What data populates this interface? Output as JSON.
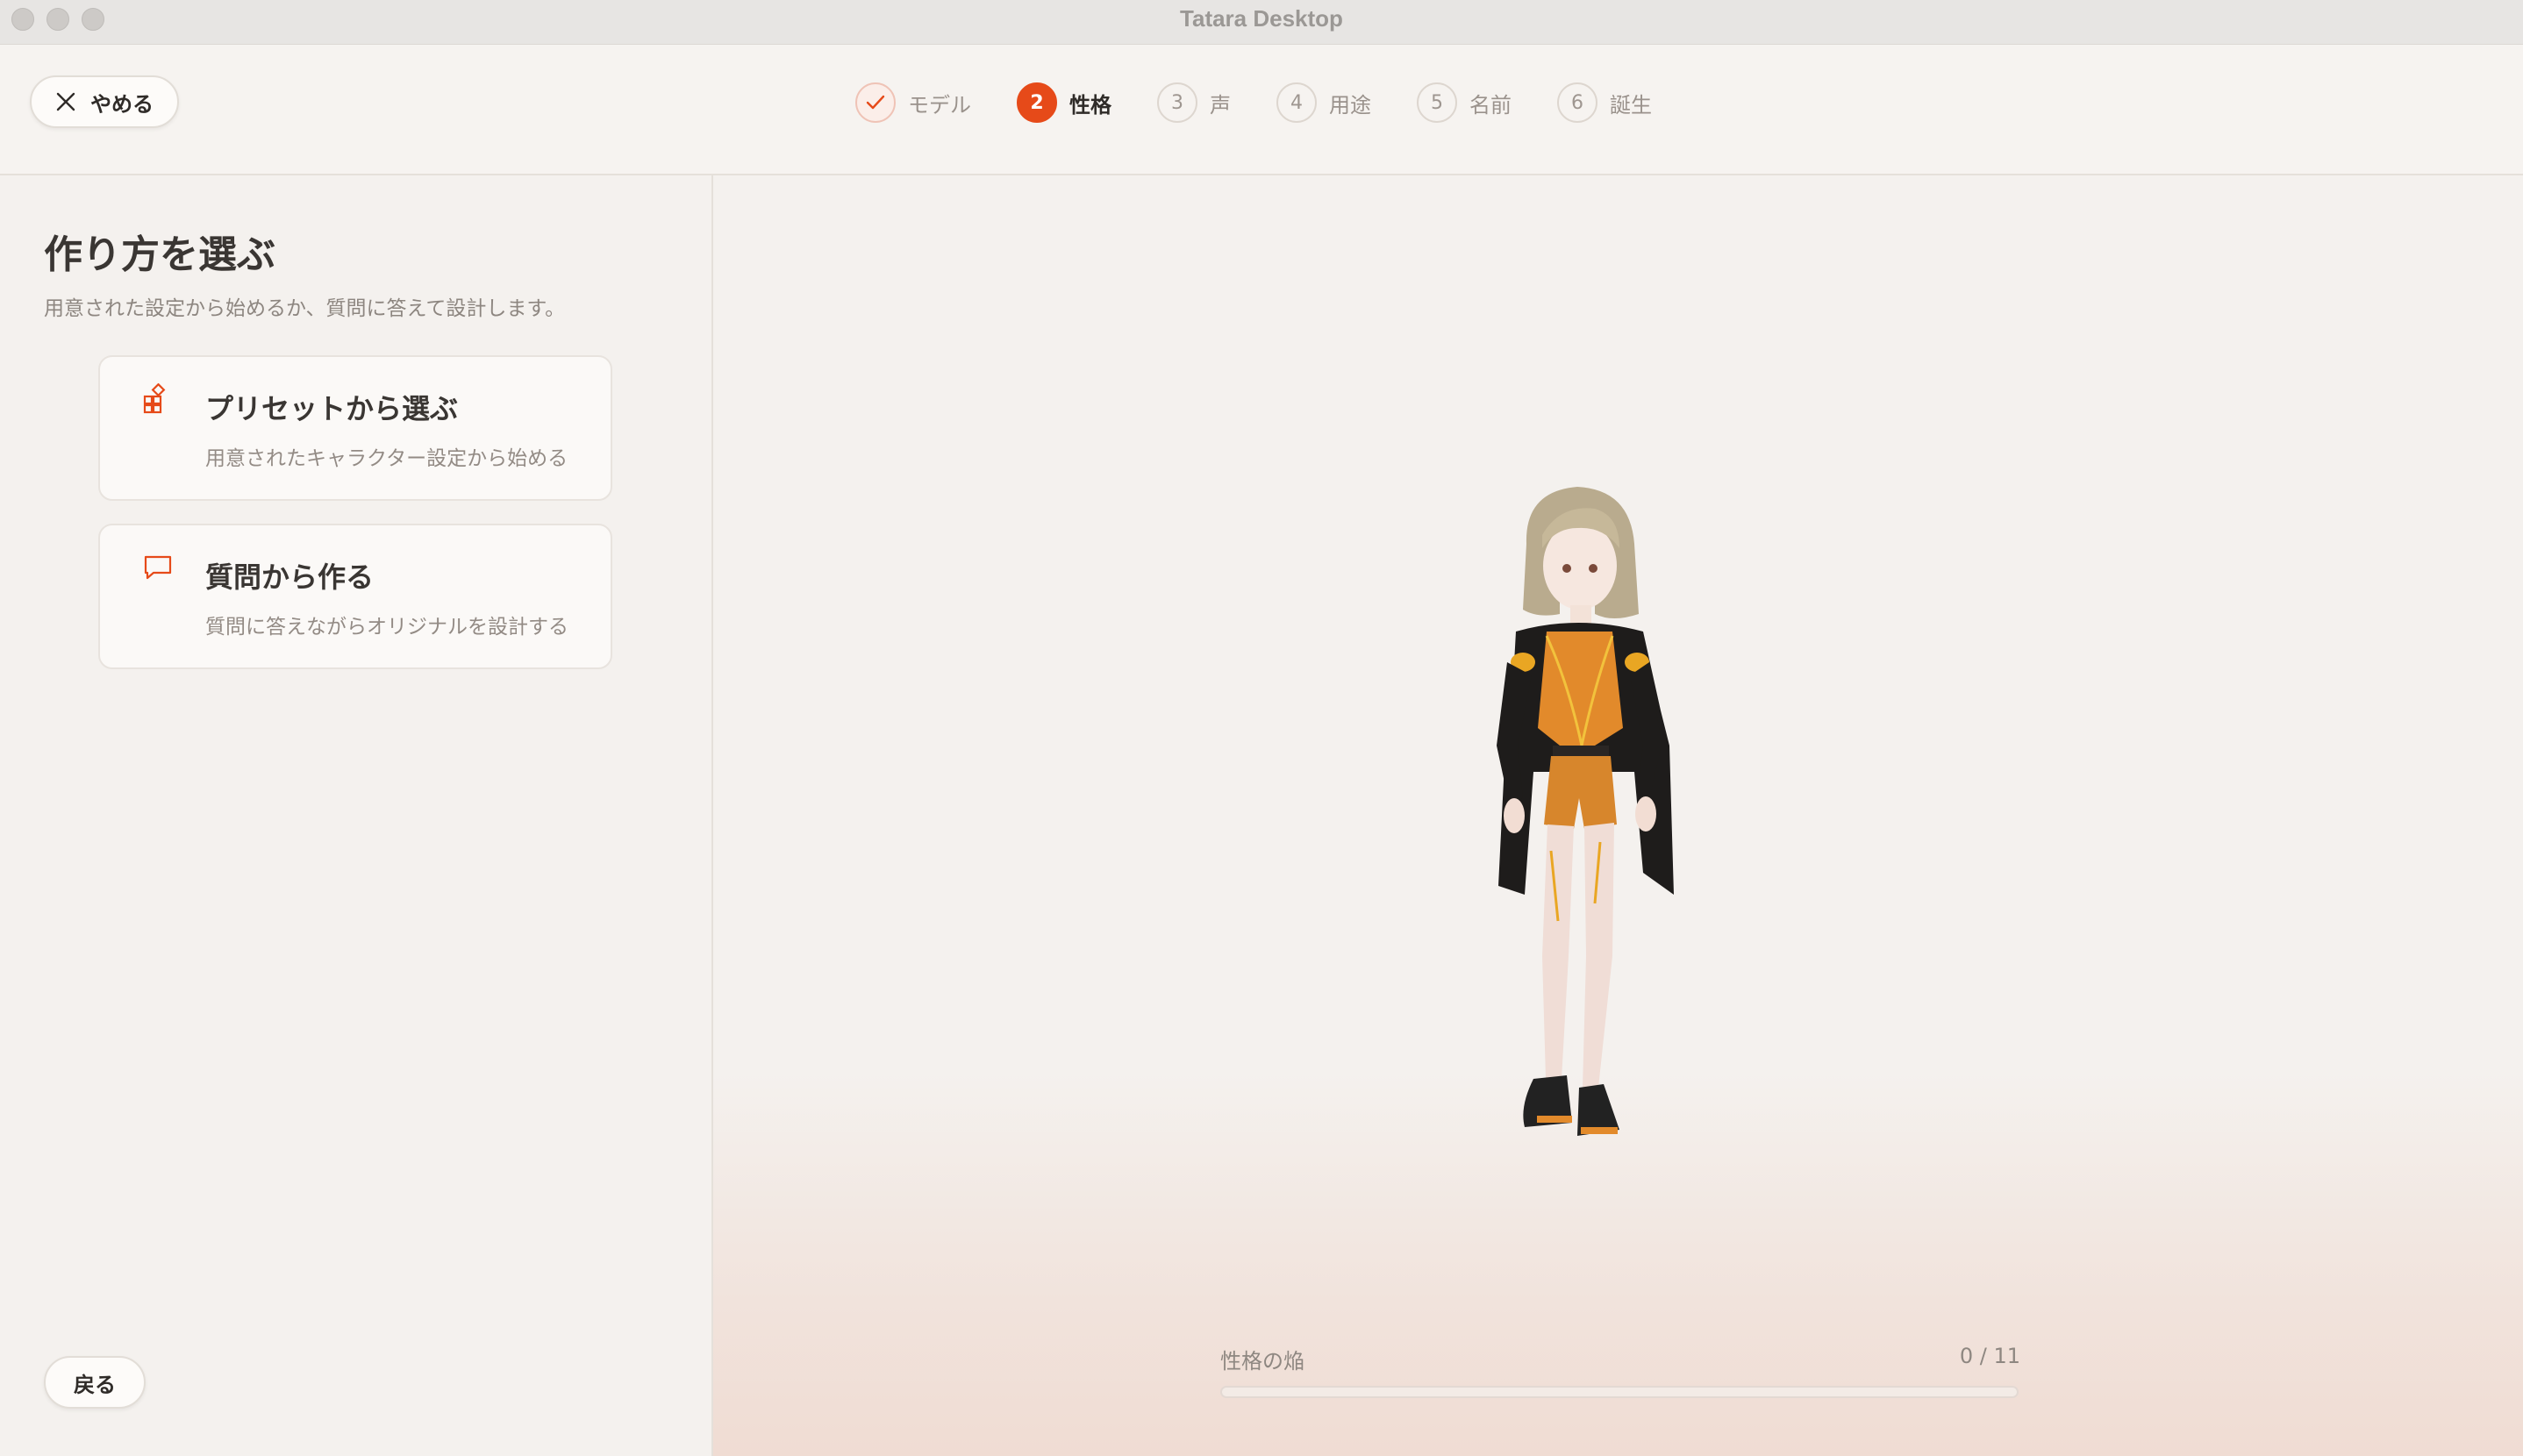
{
  "window": {
    "title": "Tatara Desktop"
  },
  "header": {
    "quit_label": "やめる",
    "steps": [
      {
        "num": "",
        "label": "モデル",
        "state": "done"
      },
      {
        "num": "2",
        "label": "性格",
        "state": "active"
      },
      {
        "num": "3",
        "label": "声",
        "state": "pending"
      },
      {
        "num": "4",
        "label": "用途",
        "state": "pending"
      },
      {
        "num": "5",
        "label": "名前",
        "state": "pending"
      },
      {
        "num": "6",
        "label": "誕生",
        "state": "pending"
      }
    ]
  },
  "sidebar": {
    "title": "作り方を選ぶ",
    "subtitle": "用意された設定から始めるか、質問に答えて設計します。",
    "options": [
      {
        "title": "プリセットから選ぶ",
        "description": "用意されたキャラクター設定から始める",
        "icon": "preset-grid-icon"
      },
      {
        "title": "質問から作る",
        "description": "質問に答えながらオリジナルを設計する",
        "icon": "chat-bubble-icon"
      }
    ],
    "back_label": "戻る"
  },
  "preview": {
    "progress_label": "性格の焔",
    "progress_count": "0 / 11",
    "progress_fraction": 0
  },
  "colors": {
    "accent": "#e64a19",
    "background": "#f4f1ee"
  }
}
